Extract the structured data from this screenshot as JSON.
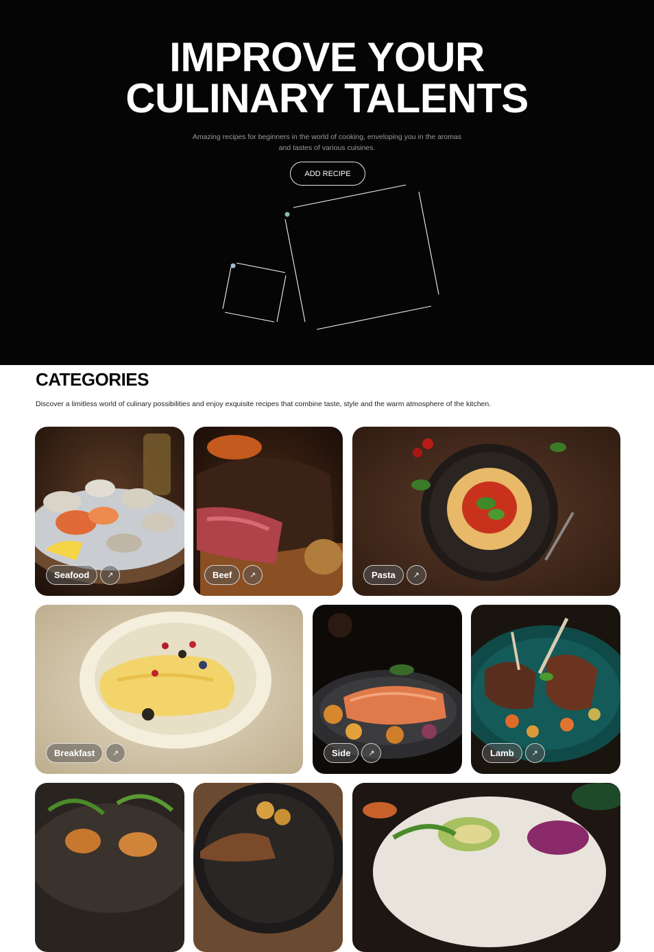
{
  "hero": {
    "title_line1": "IMPROVE YOUR",
    "title_line2": "CULINARY TALENTS",
    "subtitle_line1": "Amazing recipes for beginners in the world of cooking, enveloping you in the aromas",
    "subtitle_line2": "and tastes of various cuisines.",
    "add_recipe_label": "ADD RECIPE"
  },
  "categories": {
    "title": "CATEGORIES",
    "description": "Discover a limitless world of culinary possibilities and enjoy exquisite recipes that combine taste, style and the warm atmosphere of the kitchen.",
    "arrow_icon": "arrow-up-right-icon",
    "items": [
      {
        "label": "Seafood"
      },
      {
        "label": "Beef"
      },
      {
        "label": "Pasta"
      },
      {
        "label": "Breakfast"
      },
      {
        "label": "Side"
      },
      {
        "label": "Lamb"
      }
    ]
  }
}
